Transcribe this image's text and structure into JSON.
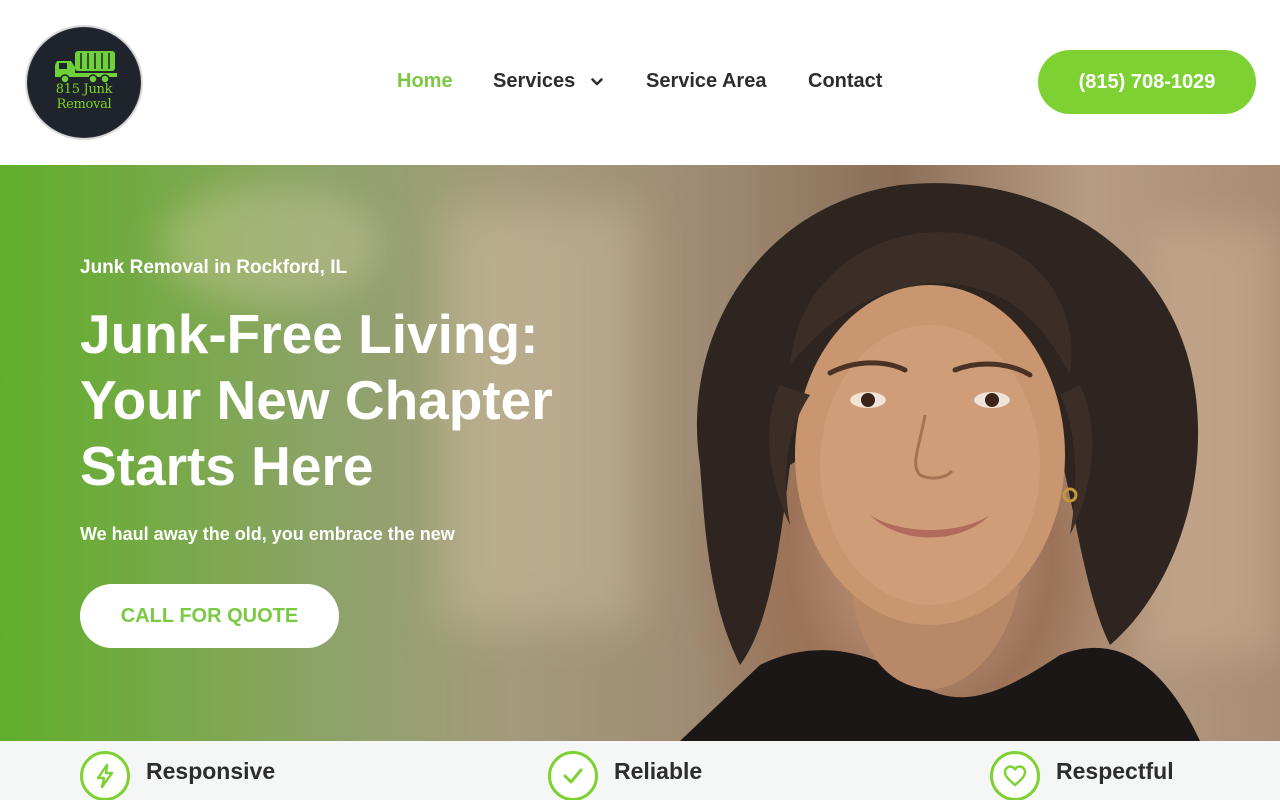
{
  "brand": {
    "logo_text": "815 Junk Removal"
  },
  "nav": {
    "items": [
      {
        "label": "Home",
        "active": true
      },
      {
        "label": "Services",
        "has_dropdown": true
      },
      {
        "label": "Service Area"
      },
      {
        "label": "Contact"
      }
    ],
    "phone": "(815) 708-1029"
  },
  "hero": {
    "subtitle": "Junk Removal in Rockford, IL",
    "title_line1": "Junk-Free Living:",
    "title_line2": "Your New Chapter",
    "title_line3": "Starts Here",
    "tagline": "We haul away the old, you embrace the new",
    "cta_label": "CALL FOR QUOTE"
  },
  "features": [
    {
      "label": "Responsive",
      "icon": "lightning-icon"
    },
    {
      "label": "Reliable",
      "icon": "checkmark-icon"
    },
    {
      "label": "Respectful",
      "icon": "heart-icon"
    }
  ],
  "colors": {
    "accent": "#7ed132",
    "nav_active": "#7ac943",
    "text_dark": "#2d2d2d",
    "logo_bg": "#1f232b"
  }
}
